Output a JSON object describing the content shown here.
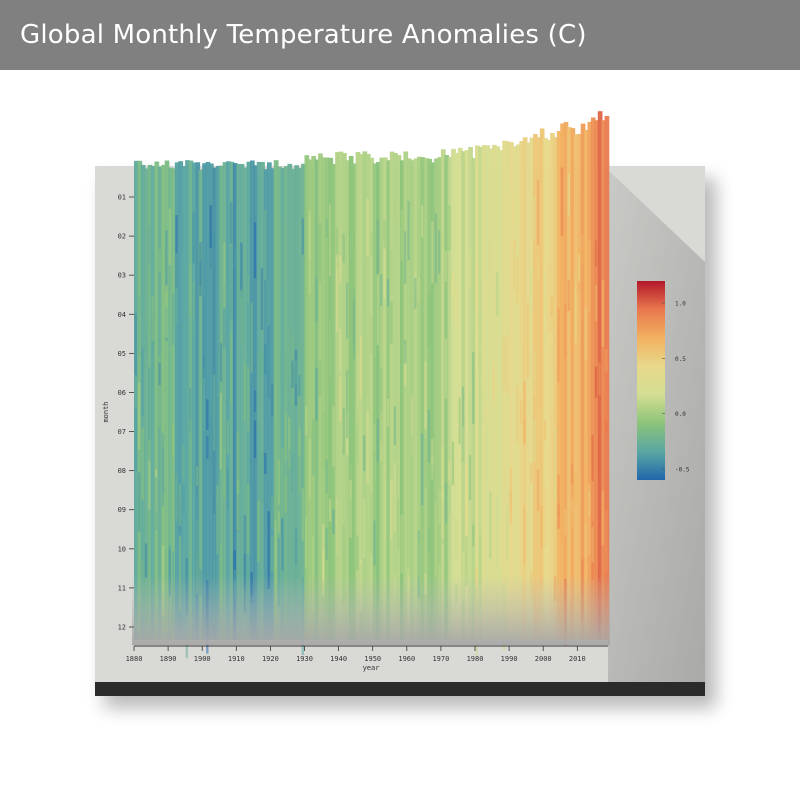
{
  "header": {
    "title": "Global Monthly Temperature Anomalies (C)"
  },
  "colors": {
    "header_bg": "#808080",
    "header_text": "#ffffff",
    "plot_wall": "#d9d9d6",
    "side_wall": "#b0b0ae",
    "base": "#2b2b2b",
    "scale": [
      "#2166ac",
      "#5aa7a3",
      "#8cc47a",
      "#d3de92",
      "#e8d88a",
      "#f2b261",
      "#e9774d",
      "#b2182b"
    ]
  },
  "chart_data": {
    "type": "heatmap",
    "title": "Global Monthly Temperature Anomalies (C)",
    "xlabel": "year",
    "ylabel": "month",
    "x_ticks": [
      "1880",
      "1890",
      "1900",
      "1910",
      "1920",
      "1930",
      "1940",
      "1950",
      "1960",
      "1970",
      "1980",
      "1990",
      "2000",
      "2010"
    ],
    "y_ticks": [
      "01",
      "02",
      "03",
      "04",
      "05",
      "06",
      "07",
      "08",
      "09",
      "10",
      "11",
      "12"
    ],
    "xlim": [
      1880,
      2018
    ],
    "zlim": [
      -0.6,
      1.2
    ],
    "colorbar_ticks": [
      {
        "label": "1.0",
        "value": 1.0
      },
      {
        "label": "0.5",
        "value": 0.5
      },
      {
        "label": "0.0",
        "value": 0.0
      },
      {
        "label": "-0.5",
        "value": -0.5
      }
    ],
    "decadal_mean_anomaly": [
      {
        "decade": 1880,
        "value": -0.2
      },
      {
        "decade": 1890,
        "value": -0.25
      },
      {
        "decade": 1900,
        "value": -0.33
      },
      {
        "decade": 1910,
        "value": -0.35
      },
      {
        "decade": 1920,
        "value": -0.27
      },
      {
        "decade": 1930,
        "value": -0.14
      },
      {
        "decade": 1940,
        "value": 0.04
      },
      {
        "decade": 1950,
        "value": -0.02
      },
      {
        "decade": 1960,
        "value": -0.01
      },
      {
        "decade": 1970,
        "value": 0.0
      },
      {
        "decade": 1980,
        "value": 0.18
      },
      {
        "decade": 1990,
        "value": 0.32
      },
      {
        "decade": 2000,
        "value": 0.52
      },
      {
        "decade": 2010,
        "value": 0.72
      }
    ],
    "grid": false,
    "colorbar_position": "right"
  }
}
